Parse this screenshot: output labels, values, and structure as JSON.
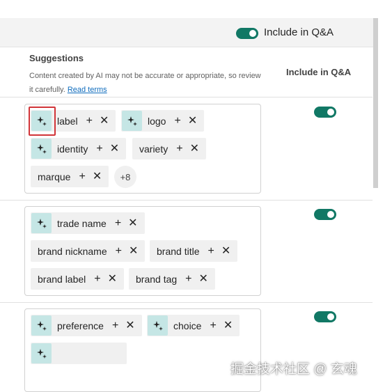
{
  "top": {
    "include_label": "Include in Q&A",
    "include_on": true
  },
  "header": {
    "suggestions_title": "Suggestions",
    "disclaimer": "Content created by AI may not be accurate or appropriate, so review it carefully.",
    "read_terms": "Read terms",
    "column_title": "Include in Q&A"
  },
  "rows": [
    {
      "include_on": true,
      "chips": [
        {
          "text": "label",
          "ai": true
        },
        {
          "text": "logo",
          "ai": true
        },
        {
          "text": "identity",
          "ai": true
        },
        {
          "text": "variety",
          "ai": false
        },
        {
          "text": "marque",
          "ai": false
        }
      ],
      "more": "+8"
    },
    {
      "include_on": true,
      "chips": [
        {
          "text": "trade name",
          "ai": true
        },
        {
          "text": "brand nickname",
          "ai": false
        },
        {
          "text": "brand title",
          "ai": false
        },
        {
          "text": "brand label",
          "ai": false
        },
        {
          "text": "brand tag",
          "ai": false
        }
      ]
    },
    {
      "include_on": true,
      "chips": [
        {
          "text": "preference",
          "ai": true
        },
        {
          "text": "choice",
          "ai": true
        },
        {
          "text": "",
          "ai": true
        }
      ]
    }
  ],
  "icons": {
    "ai_chip": "sparkle-icon",
    "add": "plus-icon",
    "remove": "close-icon"
  },
  "colors": {
    "accent": "#117865",
    "ai_chip_bg": "#c5e6e5",
    "link": "#0f6cbd",
    "highlight": "#d13438"
  },
  "watermark": "掘金技术社区 @ 玄魂"
}
